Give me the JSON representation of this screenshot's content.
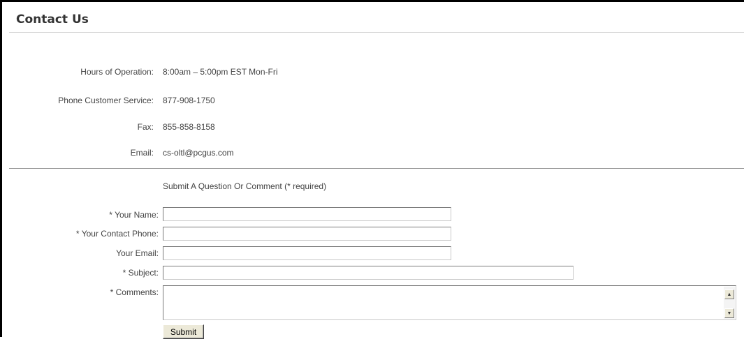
{
  "page": {
    "title": "Contact Us"
  },
  "contact_info": {
    "hours_label": "Hours of Operation:",
    "hours_value": "8:00am – 5:00pm EST Mon-Fri",
    "phone_label": "Phone Customer Service:",
    "phone_value": "877-908-1750",
    "fax_label": "Fax:",
    "fax_value": "855-858-8158",
    "email_label": "Email:",
    "email_value": "cs-oltl@pcgus.com"
  },
  "form": {
    "heading": "Submit A Question Or Comment (* required)",
    "name_label": "* Your Name:",
    "name_value": "",
    "phone_label": "* Your Contact Phone:",
    "phone_value": "",
    "email_label": "Your Email:",
    "email_value": "",
    "subject_label": "* Subject:",
    "subject_value": "",
    "comments_label": "* Comments:",
    "comments_value": "",
    "submit_label": "Submit",
    "scroll_up_icon": "▲",
    "scroll_down_icon": "▼"
  },
  "colors": {
    "frame_border": "#000000",
    "text": "#444444",
    "section_rule": "#999999"
  }
}
